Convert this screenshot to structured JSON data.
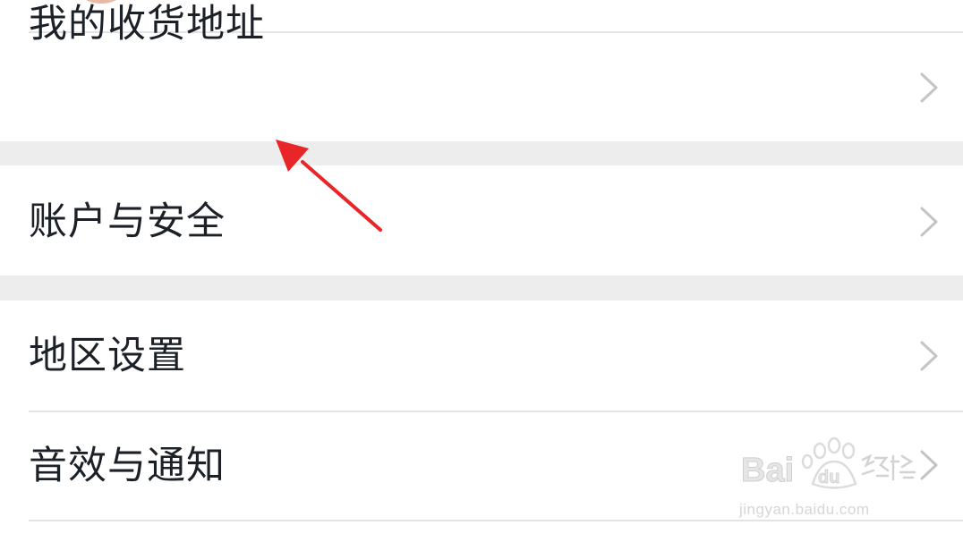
{
  "menu": {
    "items": [
      {
        "label": "我的收货地址"
      },
      {
        "label": "账户与安全"
      },
      {
        "label": "地区设置"
      },
      {
        "label": "音效与通知"
      }
    ]
  },
  "icons": {
    "chevron": "chevron-right-icon",
    "annotation": "red-arrow-annotation"
  },
  "colors": {
    "text": "#1c2128",
    "chevron": "#c4c4c4",
    "section_gap": "#ededed",
    "divider": "#e3e3e3",
    "annotation_arrow": "#e8262a"
  },
  "watermark": {
    "url": "jingyan.baidu.com"
  }
}
